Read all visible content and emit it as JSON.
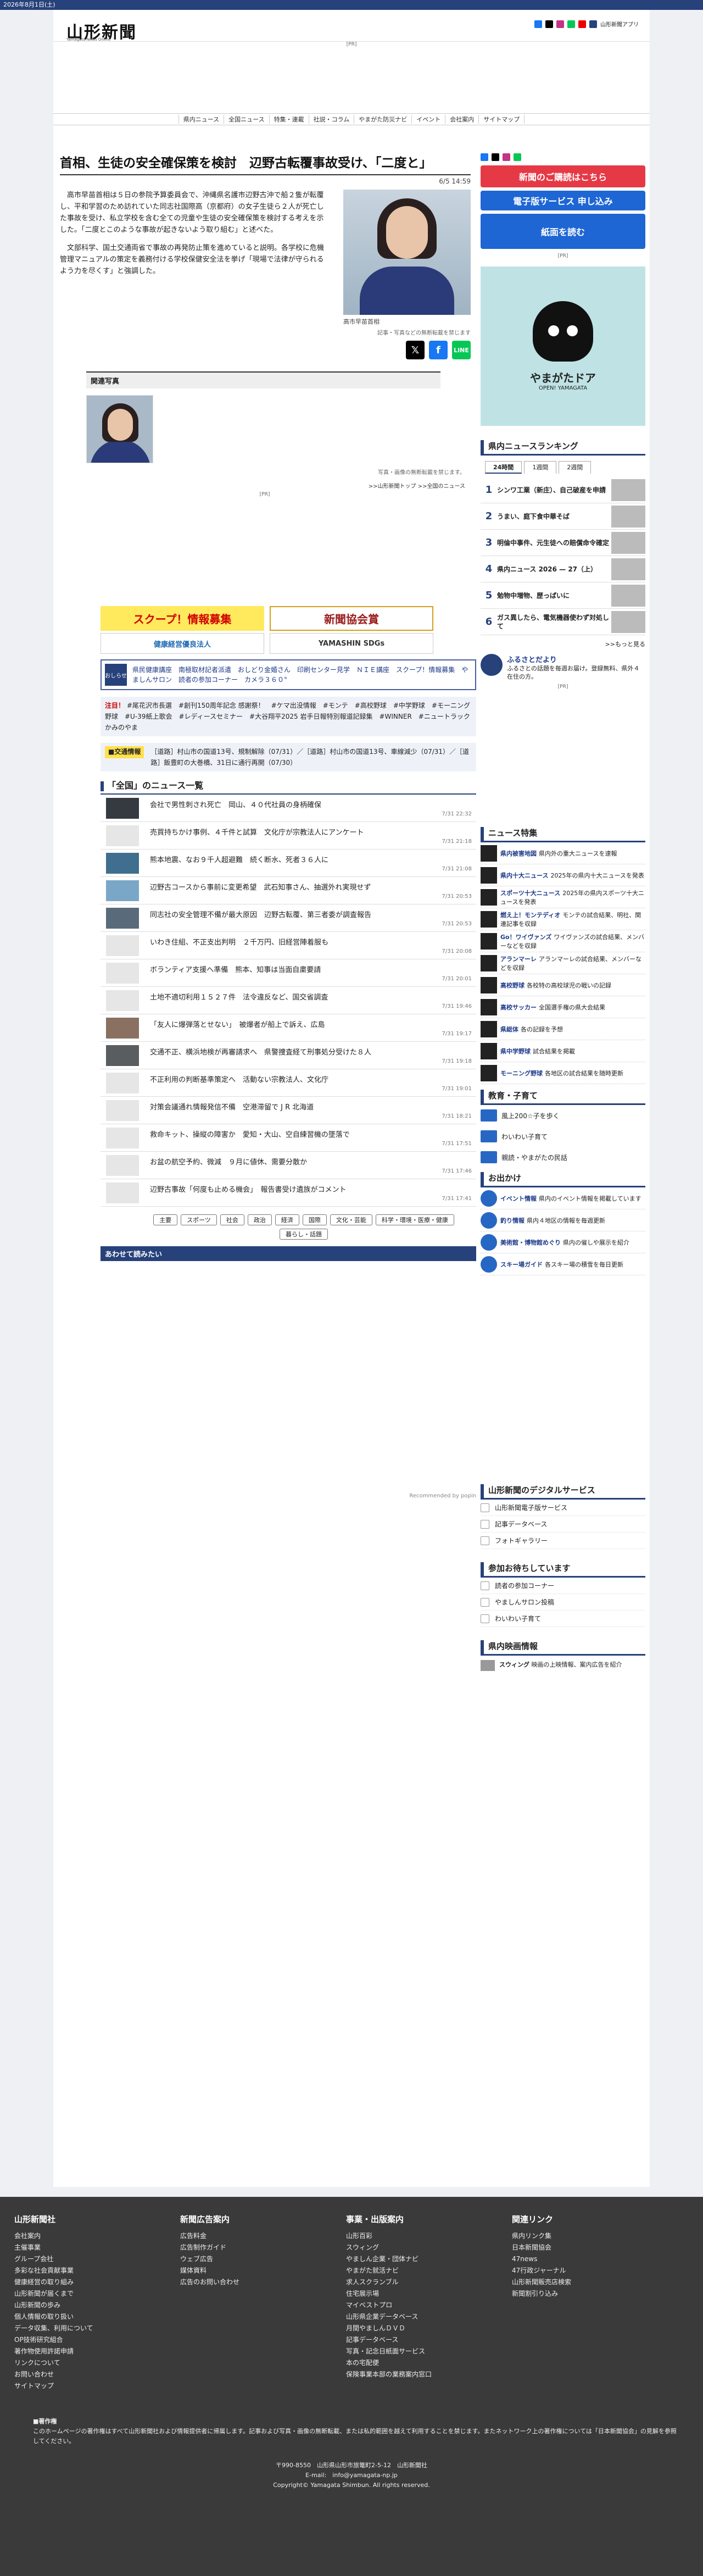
{
  "topbar": {
    "date": "2026年8月1日(土)"
  },
  "header": {
    "logo": "山形新聞",
    "logo_sub": "Yamagata News Online",
    "app_label": "山形新聞アプリ",
    "pr": "[PR]"
  },
  "nav": [
    "県内ニュース",
    "全国ニュース",
    "特集・連載",
    "社説・コラム",
    "やまがた防災ナビ",
    "イベント",
    "会社案内",
    "サイトマップ"
  ],
  "article": {
    "title": "首相、生徒の安全確保策を検討　辺野古転覆事故受け、「二度と」",
    "date": "6/5 14:59",
    "paragraphs": [
      "高市早苗首相は５日の参院予算委員会で、沖縄県名護市辺野古沖で船２隻が転覆し、平和学習のため訪れていた同志社国際高（京都府）の女子生徒ら２人が死亡した事故を受け、私立学校を含む全ての児童や生徒の安全確保策を検討する考えを示した。「二度とこのような事故が起きないよう取り組む」と述べた。",
      "文部科学、国土交通両省で事故の再発防止策を進めていると説明。各学校に危機管理マニュアルの策定を義務付ける学校保健安全法を挙げ「現場で法律が守られるよう力を尽くす」と強調した。"
    ],
    "photo_caption": "高市早苗首相",
    "photo_note": "記事・写真などの無断転載を禁じます",
    "related_head": "関連写真",
    "related_note": "写真・画像の無断転載を禁じます。",
    "top_link": ">>山形新聞トップ >>全国のニュース"
  },
  "banners": {
    "left_top": "スクープ！情報募集",
    "left_bottom": "健康経営優良法人",
    "right_top": "新聞協会賞",
    "right_bottom": "YAMASHIN SDGs"
  },
  "info": {
    "icon": "おしらせ",
    "text": "県民健康講座　南極取材記者派遣　おしどり金婚さん　印刷センター見学　ＮＩＥ講座　スクープ！情報募集　やましんサロン　読者の参加コーナー　カメラ３６０°"
  },
  "keywords": {
    "label": "注目！",
    "text": "#尾花沢市長選　#創刊150周年記念 感謝祭！　#ケマ出没情報　#モンテ　#高校野球　#中学野球　#モーニング野球　#U-39紙上歌会　#レディースセミナー　#大谷翔平2025 岩手日報特別報道記録集　#WINNER　#ニュートラックかみのやま"
  },
  "traffic": {
    "label": "■交通情報",
    "text": "［道路］村山市の国道13号、規制解除（07/31）／［道路］村山市の国道13号、車線減少（07/31）／［道路］飯豊町の大巻橋、31日に通行再開（07/30）"
  },
  "newslist": {
    "head": "「全国」のニュース一覧",
    "items": [
      {
        "title": "会社で男性刺され死亡　岡山、４０代社員の身柄確保",
        "date": "7/31 22:32"
      },
      {
        "title": "売買持ちかけ事例、４千件と試算　文化庁が宗教法人にアンケート",
        "date": "7/31 21:18"
      },
      {
        "title": "熊本地震、なお９千人超避難　続く断水、死者３６人に",
        "date": "7/31 21:08"
      },
      {
        "title": "辺野古コースから事前に変更希望　武石知事さん、抽選外れ実現せず",
        "date": "7/31 20:53"
      },
      {
        "title": "同志社の安全管理不備が最大原因　辺野古転覆、第三者委が調査報告",
        "date": "7/31 20:53"
      },
      {
        "title": "いわき住組、不正支出判明　２千万円、旧経営陣着服も",
        "date": "7/31 20:08"
      },
      {
        "title": "ボランティア支援へ準備　熊本、知事は当面自粛要請",
        "date": "7/31 20:01"
      },
      {
        "title": "土地不適切利用１５２７件　法令違反など、国交省調査",
        "date": "7/31 19:46"
      },
      {
        "title": "「友人に爆弾落とせない」　被爆者が船上で訴え、広島",
        "date": "7/31 19:17"
      },
      {
        "title": "交通不正、横浜地検が再審請求へ　県警捜査経て刑事処分受けた８人",
        "date": "7/31 19:18"
      },
      {
        "title": "不正利用の判断基準策定へ　活動ない宗教法人、文化庁",
        "date": "7/31 19:01"
      },
      {
        "title": "対策会議通れ情報発信不備　空港滞留で J R 北海道",
        "date": "7/31 18:21"
      },
      {
        "title": "救命キット、操縦の障害か　愛知・大山、空自練習機の墜落で",
        "date": "7/31 17:51"
      },
      {
        "title": "お盆の航空予約、微減　９月に値休、需要分散か",
        "date": "7/31 17:46"
      },
      {
        "title": "辺野古事故「何度も止める機会」　報告書受け遺族がコメント",
        "date": "7/31 17:41"
      }
    ]
  },
  "categories": [
    "主要",
    "スポーツ",
    "社会",
    "政治",
    "経済",
    "国際",
    "文化・芸能",
    "科学・環境・医療・健康",
    "暮らし・話題"
  ],
  "awase": "あわせて読みたい",
  "recommended": "Recommended by popin",
  "side": {
    "subscribe": "新聞のご購読はこちら",
    "e_paper": "電子版サービス 申し込み",
    "read_paper": "紙面を読む",
    "door": "やまがたドア",
    "door_sub": "OPEN! YAMAGATA",
    "ranking_head": "県内ニュースランキング",
    "ranking_tabs": [
      "24時間",
      "1週間",
      "2週間"
    ],
    "ranking": [
      {
        "n": "1",
        "t": "シンワ工業（新庄）、自己破産を申請"
      },
      {
        "n": "2",
        "t": "うまい、庭下食中華そば"
      },
      {
        "n": "3",
        "t": "明倫中事件、元生徒への賠償命令確定"
      },
      {
        "n": "4",
        "t": "県内ニュース 2026 — 27（上）"
      },
      {
        "n": "5",
        "t": "勉物中増物、歴っぱいに"
      },
      {
        "n": "6",
        "t": "ガス異したら、電気機器使わず対処して"
      }
    ],
    "more": ">>もっと見る",
    "furusato": "ふるさとだより",
    "furusato_text": "ふるさとの話題を毎週お届け。登録無料、県外４在住の方。",
    "feature_head": "ニュース特集",
    "features": [
      {
        "b": "県内被害地図",
        "t": "県内外の重大ニュースを速報"
      },
      {
        "b": "県内十大ニュース",
        "t": "2025年の県内十大ニュースを発表"
      },
      {
        "b": "スポーツ十大ニュース",
        "t": "2025年の県内スポーツ十大ニュースを発表"
      },
      {
        "b": "燃え上！モンテディオ",
        "t": "モンテの試合結果、明社、関連記事を収録"
      },
      {
        "b": "Go！ワイヴァンズ",
        "t": "ワイヴァンズの試合結果、メンバーなどを収録"
      },
      {
        "b": "アランマーレ",
        "t": "アランマーレの試合結果、メンバーなどを収録"
      },
      {
        "b": "高校野球",
        "t": "各校特の高校球児の戦いの記録"
      },
      {
        "b": "高校サッカー",
        "t": "全国選手権の県大会結果"
      },
      {
        "b": "県総体",
        "t": "各の記録を予想"
      },
      {
        "b": "県中学野球",
        "t": "試合結果を掲載"
      },
      {
        "b": "モーニング野球",
        "t": "各地区の試合結果を随時更新"
      }
    ],
    "edu_head": "教育・子育て",
    "edu": [
      "風上200☆子を歩く",
      "わいわい子育て",
      "親読・やまがたの民話"
    ],
    "out_head": "お出かけ",
    "out": [
      {
        "b": "イベント情報",
        "t": "県内のイベント情報を掲載しています"
      },
      {
        "b": "釣り情報",
        "t": "県内４地区の情報を毎週更新"
      },
      {
        "b": "美術館・博物館めぐり",
        "t": "県内の催しや展示を紹介"
      },
      {
        "b": "スキー場ガイド",
        "t": "各スキー場の積雪を毎日更新"
      }
    ],
    "digital_head": "山形新聞のデジタルサービス",
    "digital": [
      "山形新聞電子版サービス",
      "記事データベース",
      "フォトギャラリー"
    ],
    "join_head": "参加お待ちしています",
    "join": [
      "読者の参加コーナー",
      "やましんサロン投稿",
      "わいわい子育て"
    ],
    "movie_head": "県内映画情報",
    "movie_title": "スウィング",
    "movie_text": "映画の上映情報、案内広告を紹介"
  },
  "footer": {
    "cols": [
      {
        "h": "山形新聞社",
        "items": [
          "会社案内",
          "主催事業",
          "グループ会社",
          "多彩な社会貢献事業",
          "健康経営の取り組み",
          "山形新聞が届くまで",
          "山形新聞の歩み",
          "個人情報の取り扱い",
          "データ収集、利用について",
          "OP技術研究組合",
          "著作物使用許諾申請",
          "リンクについて",
          "お問い合わせ",
          "サイトマップ"
        ]
      },
      {
        "h": "新聞広告案内",
        "items": [
          "広告料金",
          "広告制作ガイド",
          "ウェブ広告",
          "媒体資料",
          "広告のお問い合わせ"
        ]
      },
      {
        "h": "事業・出版案内",
        "items": [
          "山形百彩",
          "スウィング",
          "やましん企業・団体ナビ",
          "やまがた就活ナビ",
          "求人スクランブル",
          "住宅展示場",
          "マイベストプロ",
          "山形県企業データベース",
          "月間やましんＤＶＤ",
          "記事データベース",
          "写真・記念日紙面サービス",
          "本の宅配便",
          "保険事業本部の業務案内窓口"
        ]
      },
      {
        "h": "関連リンク",
        "items": [
          "県内リンク集",
          "日本新聞協会",
          "47news",
          "47行政ジャーナル",
          "山形新聞販売店検索",
          "新聞割引り込み"
        ]
      }
    ],
    "note_title": "■著作権",
    "note": "このホームページの著作権はすべて山形新聞社および情報提供者に帰属します。記事および写真・画像の無断転載、または私的範囲を越えて利用することを禁じます。またネットワーク上の著作権については「日本新聞協会」の見解を参照してください。",
    "addr1": "〒990-8550　山形県山形市旅篭町2-5-12　山形新聞社",
    "addr2": "E-mail:　info@yamagata-np.jp",
    "copy": "Copyright© Yamagata Shimbun. All rights reserved."
  }
}
